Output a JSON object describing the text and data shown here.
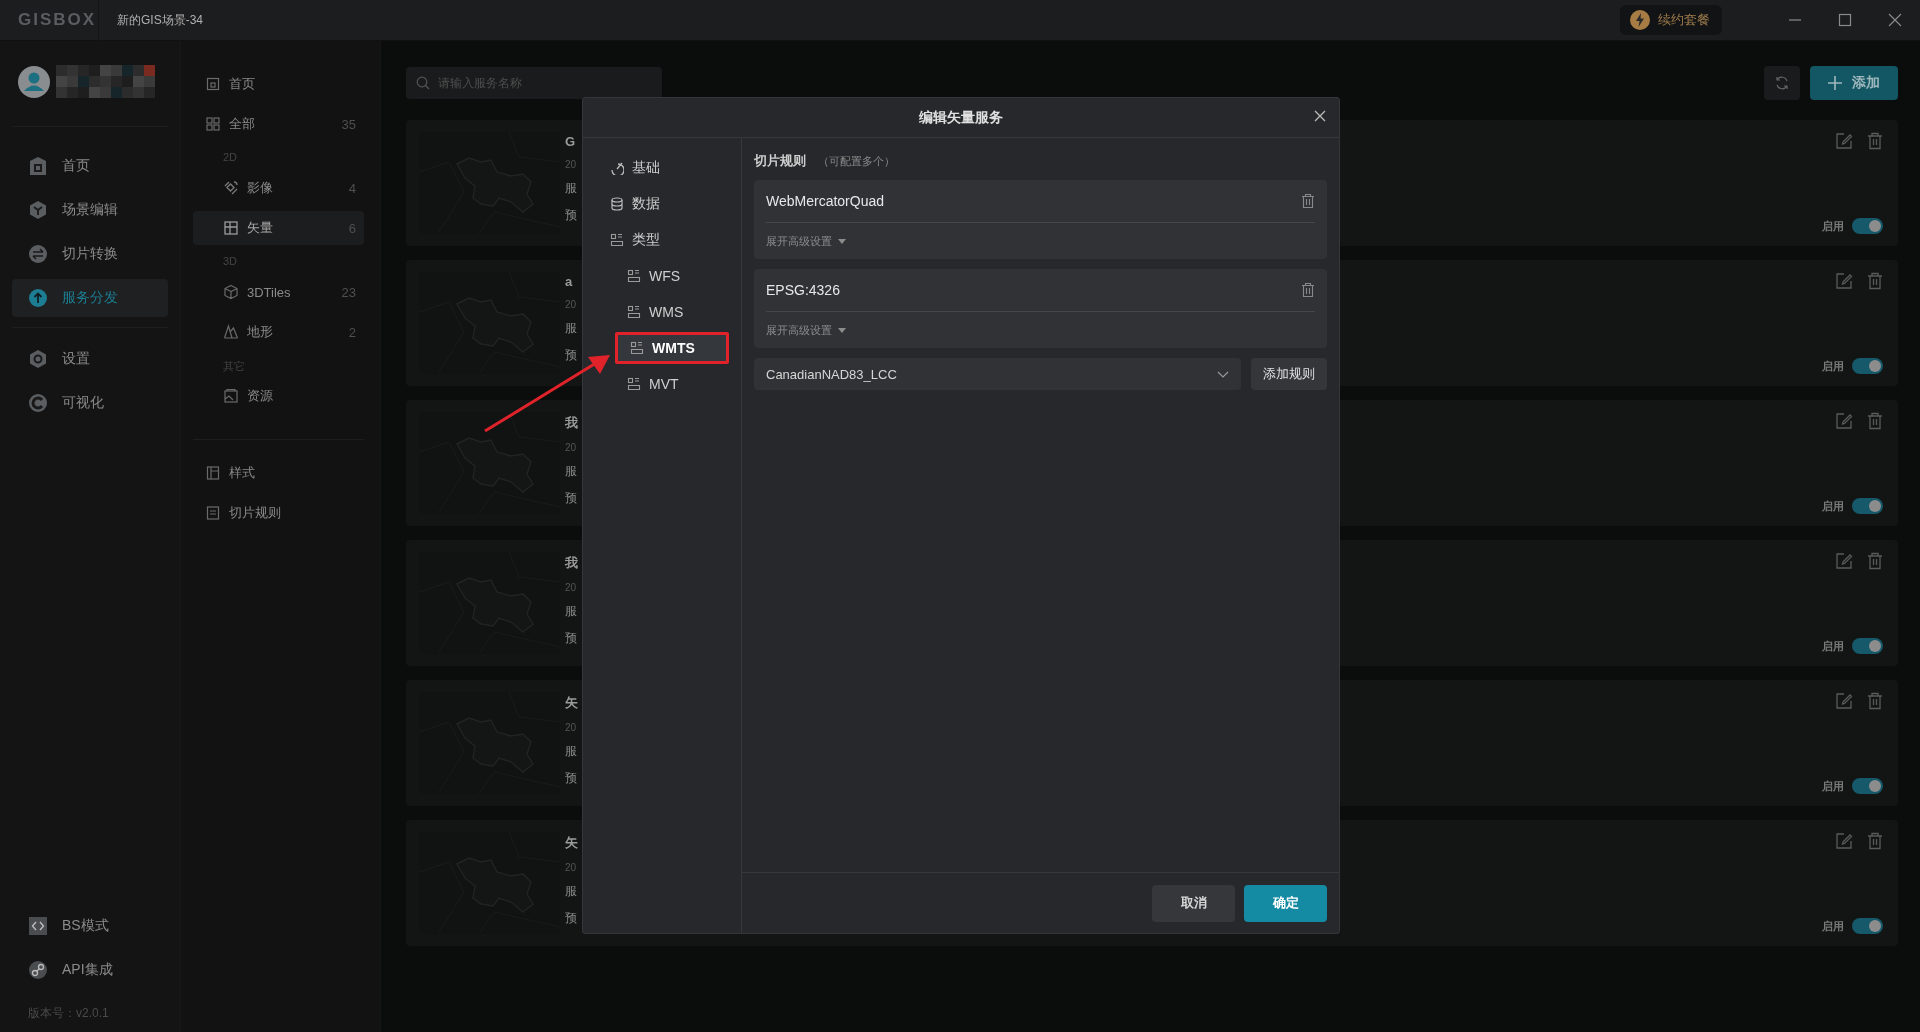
{
  "window": {
    "logo": "GISBOX",
    "title": "新的GIS场景-34",
    "renew_button": "续约套餐"
  },
  "nav": {
    "items": [
      {
        "label": "首页",
        "selected": false
      },
      {
        "label": "场景编辑",
        "selected": false
      },
      {
        "label": "切片转换",
        "selected": false
      },
      {
        "label": "服务分发",
        "selected": true
      },
      {
        "label": "设置",
        "selected": false
      },
      {
        "label": "可视化",
        "selected": false
      }
    ],
    "bottom_items": [
      {
        "label": "BS模式"
      },
      {
        "label": "API集成"
      }
    ],
    "version": "版本号：v2.0.1"
  },
  "library": {
    "items": [
      {
        "kind": "link",
        "label": "首页",
        "selected": false
      },
      {
        "kind": "link",
        "label": "全部",
        "count": "35",
        "selected": false
      },
      {
        "kind": "group",
        "label": "2D",
        "children": [
          {
            "label": "影像",
            "count": "4",
            "selected": false
          },
          {
            "label": "矢量",
            "count": "6",
            "selected": true
          }
        ]
      },
      {
        "kind": "group",
        "label": "3D",
        "children": [
          {
            "label": "3DTiles",
            "count": "23",
            "selected": false
          },
          {
            "label": "地形",
            "count": "2",
            "selected": false
          }
        ]
      },
      {
        "kind": "group",
        "label": "其它",
        "children": [
          {
            "label": "资源",
            "selected": false
          }
        ]
      }
    ],
    "bottom_items": [
      {
        "label": "样式",
        "selected": false
      },
      {
        "label": "切片规则",
        "selected": false
      }
    ]
  },
  "search": {
    "placeholder": "请输入服务名称"
  },
  "add_button": "添加",
  "cards": [
    {
      "title": "G",
      "line_1": "20",
      "line_2": "服",
      "line_3": "预",
      "status_label": "启用",
      "enabled": true
    },
    {
      "title": "a",
      "line_1": "20",
      "line_2": "服",
      "line_3": "预",
      "status_label": "启用",
      "enabled": true
    },
    {
      "title": "我",
      "line_1": "20",
      "line_2": "服",
      "line_3": "预",
      "status_label": "启用",
      "enabled": true
    },
    {
      "title": "我",
      "line_1": "20",
      "line_2": "服",
      "line_3": "预",
      "status_label": "启用",
      "enabled": true
    },
    {
      "title": "矢",
      "line_1": "20",
      "line_2": "服",
      "line_3": "预",
      "status_label": "启用",
      "enabled": true
    },
    {
      "title": "矢",
      "line_1": "20",
      "line_2": "服",
      "line_3": "预",
      "status_label": "启用",
      "enabled": true
    }
  ],
  "dialog": {
    "title": "编辑矢量服务",
    "nav": [
      {
        "label": "基础",
        "selected": false
      },
      {
        "label": "数据",
        "selected": false
      },
      {
        "label": "类型",
        "selected": false,
        "children": [
          {
            "label": "WFS",
            "selected": false,
            "highlighted": false
          },
          {
            "label": "WMS",
            "selected": false,
            "highlighted": false
          },
          {
            "label": "WMTS",
            "selected": true,
            "highlighted": true
          },
          {
            "label": "MVT",
            "selected": false,
            "highlighted": false
          }
        ]
      }
    ],
    "section_title": "切片规则",
    "section_hint": "（可配置多个）",
    "rules": [
      {
        "name": "WebMercatorQuad",
        "expand_label": "展开高级设置"
      },
      {
        "name": "EPSG:4326",
        "expand_label": "展开高级设置"
      }
    ],
    "rule_select": {
      "value": "CanadianNAD83_LCC"
    },
    "add_rule_button": "添加规则",
    "cancel_button": "取消",
    "ok_button": "确定"
  }
}
